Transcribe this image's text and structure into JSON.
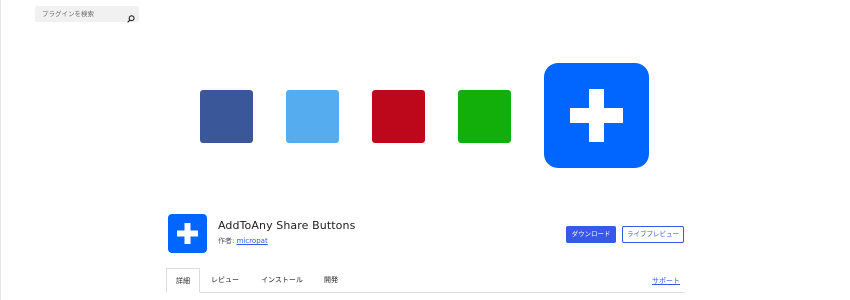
{
  "search": {
    "placeholder": "プラグインを検索",
    "icon": "search-icon"
  },
  "banner": {
    "tiles": [
      {
        "name": "facebook-blue-tile",
        "color": "#3a579a"
      },
      {
        "name": "twitter-lightblue-tile",
        "color": "#55acee"
      },
      {
        "name": "pinterest-red-tile",
        "color": "#bd081c"
      },
      {
        "name": "green-share-tile",
        "color": "#12af0a"
      }
    ],
    "featured_icon": "plus-icon",
    "featured_color": "#0166ff"
  },
  "plugin": {
    "name": "AddToAny Share Buttons",
    "author_label": "作者:",
    "author_name": "micropat",
    "icon": "plus-icon"
  },
  "actions": {
    "download_label": "ダウンロード",
    "preview_label": "ライブプレビュー"
  },
  "tabs": [
    {
      "label": "詳細",
      "active": true
    },
    {
      "label": "レビュー",
      "active": false
    },
    {
      "label": "インストール",
      "active": false
    },
    {
      "label": "開発",
      "active": false
    }
  ],
  "support_label": "サポート",
  "colors": {
    "accent": "#3858e9",
    "brand": "#0166ff"
  }
}
